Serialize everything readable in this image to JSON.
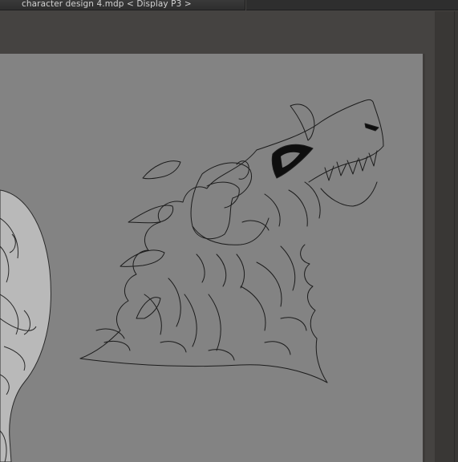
{
  "document_tab": {
    "title": "character design 4.mdp < Display P3 >"
  }
}
